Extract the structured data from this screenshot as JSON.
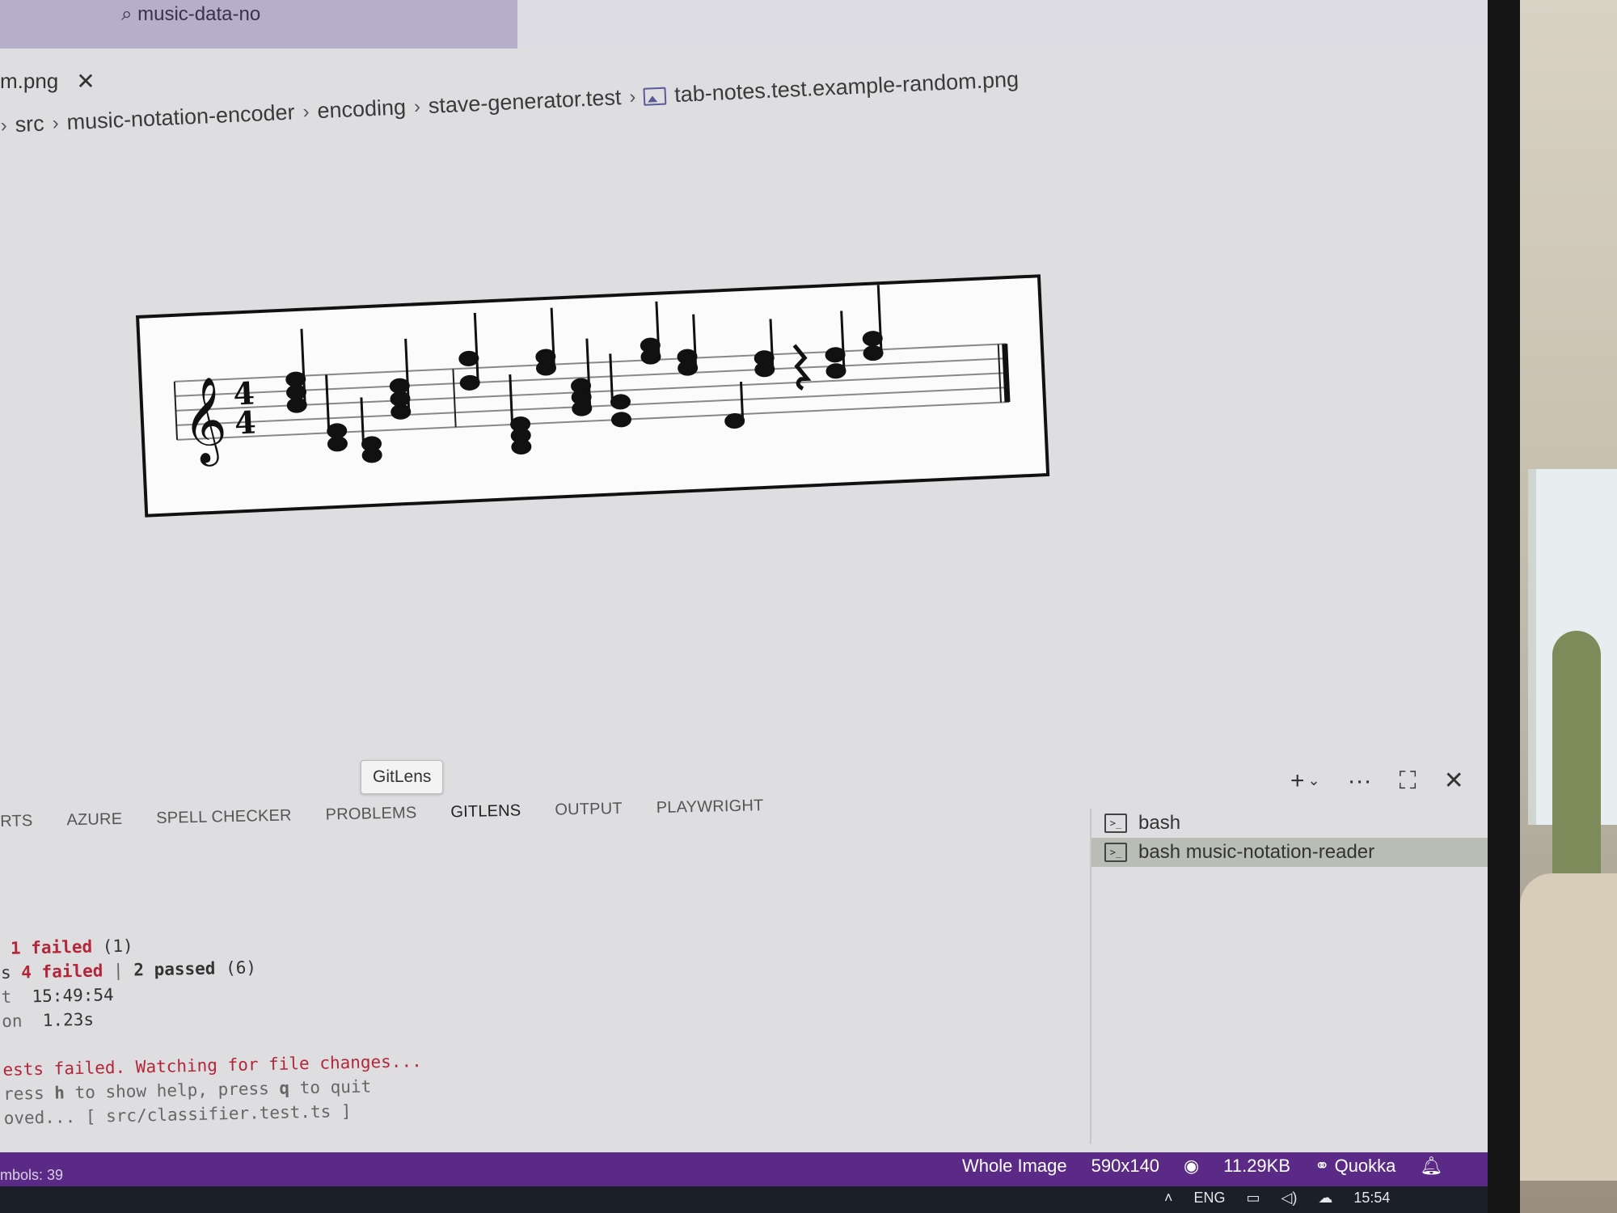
{
  "command_center": {
    "text": "music-data-no"
  },
  "editor_tab": {
    "name": "m.png",
    "close": "✕"
  },
  "breadcrumb": {
    "items": [
      "src",
      "music-notation-encoder",
      "encoding",
      "stave-generator.test",
      "tab-notes.test.example-random.png"
    ],
    "separator": "›"
  },
  "preview": {
    "image_semantic": "music-staff-with-treble-clef-4-4-chords"
  },
  "tooltip": {
    "text": "GitLens"
  },
  "panel_tabs": [
    "RTS",
    "AZURE",
    "SPELL CHECKER",
    "PROBLEMS",
    "GITLENS",
    "OUTPUT",
    "PLAYWRIGHT"
  ],
  "panel_actions": {
    "add": "+",
    "chevron": "⌄",
    "more": "···",
    "maximize": "⛶",
    "close": "✕"
  },
  "terminal": {
    "line1": {
      "prefix": " ",
      "failed": "1 failed",
      "rest": " (1)"
    },
    "line2": {
      "prefix": "s ",
      "failed": "4 failed",
      "sep": " | ",
      "passed": "2 passed",
      "rest": " (6)"
    },
    "line3": {
      "prefix": "t  ",
      "value": "15:49:54"
    },
    "line4": {
      "prefix": "on  ",
      "value": "1.23s"
    },
    "line5": "ests failed. Watching for file changes...",
    "line6": {
      "a": "ress ",
      "k1": "h",
      "b": " to show help, press ",
      "k2": "q",
      "c": " to quit"
    },
    "line7": {
      "a": "oved... [ ",
      "path": "src/classifier.test.ts",
      "c": " ]"
    }
  },
  "terminal_list": [
    {
      "label": "bash",
      "selected": false
    },
    {
      "label": "bash  music-notation-reader",
      "selected": true
    }
  ],
  "status_bar": {
    "left": "mbols: 39",
    "whole_image": "Whole Image",
    "dimensions": "590x140",
    "copilot_icon": "copilot-icon",
    "size": "11.29KB",
    "quokka": "Quokka",
    "bell_icon": "bell-icon",
    "color": "#5b2a86"
  },
  "taskbar": {
    "lang": "ENG",
    "time": "15:54"
  }
}
